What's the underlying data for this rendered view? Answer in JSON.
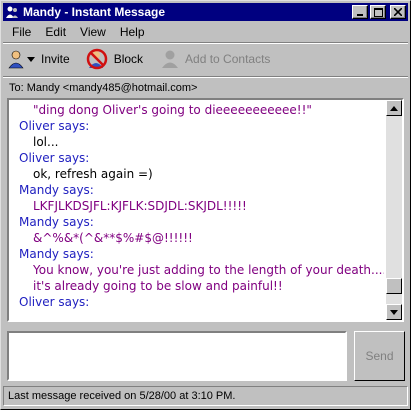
{
  "window": {
    "title": "Mandy - Instant Message"
  },
  "menu": [
    "File",
    "Edit",
    "View",
    "Help"
  ],
  "toolbar": {
    "invite": "Invite",
    "block": "Block",
    "add_contacts": "Add to Contacts"
  },
  "to_line": "To:  Mandy <mandy485@hotmail.com>",
  "chat": [
    {
      "type": "msg",
      "who": "mandy",
      "text": "\"ding dong Oliver's going to dieeeeeeeeeee!!\""
    },
    {
      "type": "who",
      "text": "Oliver says:"
    },
    {
      "type": "msg",
      "who": "oliver",
      "text": "lol..."
    },
    {
      "type": "who",
      "text": "Oliver says:"
    },
    {
      "type": "msg",
      "who": "oliver",
      "text": "ok, refresh again =)"
    },
    {
      "type": "who",
      "text": "Mandy says:"
    },
    {
      "type": "msg",
      "who": "mandy",
      "text": "LKFJLKDSJFL:KJFLK:SDJDL:SKJDL!!!!!"
    },
    {
      "type": "who",
      "text": "Mandy says:"
    },
    {
      "type": "msg",
      "who": "mandy",
      "text": "&^%&*(^&**$%#$@!!!!!!"
    },
    {
      "type": "who",
      "text": "Mandy says:"
    },
    {
      "type": "msg",
      "who": "mandy",
      "text": "You know, you're just adding to the length of your death...."
    },
    {
      "type": "msg",
      "who": "mandy",
      "text": "it's already going to be slow and painful!!"
    },
    {
      "type": "who",
      "text": "Oliver says:"
    }
  ],
  "send_label": "Send",
  "status": "Last message received on 5/28/00 at 3:10 PM.",
  "colors": {
    "titlebar": "#000080",
    "sender": "#2020c0",
    "mandy_text": "#800080"
  }
}
